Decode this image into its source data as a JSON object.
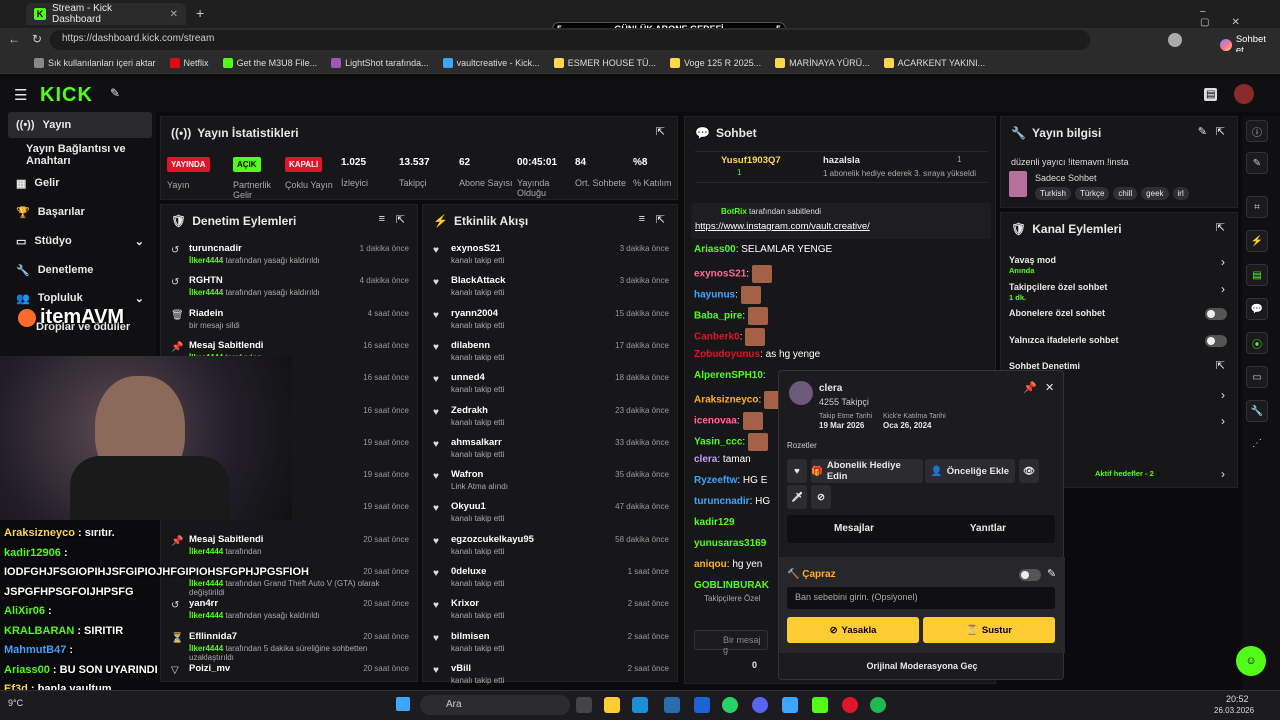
{
  "browser": {
    "tab_title": "Stream - Kick Dashboard",
    "url": "https://dashboard.kick.com/stream",
    "profile_label": "Sohbet et",
    "bookmarks": [
      "Sık kullanılanları içeri aktar",
      "Netflix",
      "Get the M3U8 File...",
      "LightShot tarafında...",
      "vaultcreative - Kick...",
      "ESMER HOUSE TÜ...",
      "Voge 125 R 2025...",
      "MARİNAYA YÜRÜ...",
      "ACARKENT YAKINI..."
    ]
  },
  "goal": {
    "left": "5",
    "label": "GÜNLÜK ABONE GEDEFİ",
    "right": "5"
  },
  "logo": "KICK",
  "sidebar": [
    "Yayın",
    "Yayın Bağlantısı ve Anahtarı",
    "Gelir",
    "Başarılar",
    "Stüdyo",
    "Denetleme",
    "Topluluk",
    "Droplar ve ödüller"
  ],
  "stats": {
    "title": "Yayın İstatistikleri",
    "items": [
      {
        "badge": "YAYINDA",
        "color": "#e0142b",
        "label": "Yayın"
      },
      {
        "badge": "AÇIK",
        "color": "#53fc18",
        "label": "Partnerlik Gelir"
      },
      {
        "badge": "KAPALI",
        "color": "#e0142b",
        "label": "Çoklu Yayın"
      },
      {
        "value": "1.025",
        "label": "İzleyici"
      },
      {
        "value": "13.537",
        "label": "Takipçi"
      },
      {
        "value": "62",
        "label": "Abone Sayısı"
      },
      {
        "value": "00:45:01",
        "label": "Yayında Olduğu"
      },
      {
        "value": "84",
        "label": "Ort. Sohbete"
      },
      {
        "value": "%8",
        "label": "% Katılım"
      }
    ]
  },
  "mod": {
    "title": "Denetim Eylemleri",
    "rows": [
      {
        "name": "turuncnadir",
        "sub": "İlker4444",
        "rest": " tarafından yasağı kaldırıldı",
        "time": "1 dakika önce",
        "icon": "↺"
      },
      {
        "name": "RGHTN",
        "sub": "İlker4444",
        "rest": " tarafından yasağı kaldırıldı",
        "time": "4 dakika önce",
        "icon": "↺"
      },
      {
        "name": "Riadein",
        "sub": "",
        "rest": "bir mesajı sildi",
        "time": "4 saat önce",
        "icon": "🗑"
      },
      {
        "name": "Mesaj Sabitlendi",
        "sub": "İlker4444",
        "rest": " tarafından",
        "time": "16 saat önce",
        "icon": "📌"
      },
      {
        "name": "",
        "sub": "",
        "rest": "ıldı",
        "time": "16 saat önce",
        "icon": ""
      },
      {
        "name": "",
        "sub": "",
        "rest": "ıldı",
        "time": "16 saat önce",
        "icon": ""
      },
      {
        "name": "",
        "sub": "",
        "rest": "ldı",
        "time": "19 saat önce",
        "icon": ""
      },
      {
        "name": "",
        "sub": "",
        "rest": "ldı",
        "time": "19 saat önce",
        "icon": ""
      },
      {
        "name": "",
        "sub": "",
        "rest": "",
        "time": "19 saat önce",
        "icon": ""
      },
      {
        "name": "Mesaj Sabitlendi",
        "sub": "İlker4444",
        "rest": " tarafından",
        "time": "20 saat önce",
        "icon": "📌"
      },
      {
        "name": "",
        "sub": "İlker4444",
        "rest": " tarafından Grand Theft Auto V (GTA) olarak değiştirildi",
        "time": "20 saat önce",
        "icon": ""
      },
      {
        "name": "yan4rr",
        "sub": "İlker4444",
        "rest": " tarafından yasağı kaldırıldı",
        "time": "20 saat önce",
        "icon": "↺"
      },
      {
        "name": "Efllinnida7",
        "sub": "İlker4444",
        "rest": " tarafından 5 dakika süreliğine sohbetten uzaklaştırıldı",
        "time": "20 saat önce",
        "icon": "⏳"
      },
      {
        "name": "Poizi_mv",
        "sub": "",
        "rest": "",
        "time": "20 saat önce",
        "icon": "▽"
      }
    ]
  },
  "activity": {
    "title": "Etkinlik Akışı",
    "rows": [
      {
        "name": "exynosS21",
        "sub": "kanalı takip etti",
        "time": "3 dakika önce"
      },
      {
        "name": "BlackAttack",
        "sub": "kanalı takip etti",
        "time": "3 dakika önce"
      },
      {
        "name": "ryann2004",
        "sub": "kanalı takip etti",
        "time": "15 dakika önce"
      },
      {
        "name": "dilabenn",
        "sub": "kanalı takip etti",
        "time": "17 dakika önce"
      },
      {
        "name": "unned4",
        "sub": "kanalı takip etti",
        "time": "18 dakika önce"
      },
      {
        "name": "Zedrakh",
        "sub": "kanalı takip etti",
        "time": "23 dakika önce"
      },
      {
        "name": "ahmsalkarr",
        "sub": "kanalı takip etti",
        "time": "33 dakika önce"
      },
      {
        "name": "Wafron",
        "sub": "Link Atma alındı",
        "time": "35 dakika önce"
      },
      {
        "name": "Okyuu1",
        "sub": "kanalı takip etti",
        "time": "47 dakika önce"
      },
      {
        "name": "egzozcukelkayu95",
        "sub": "kanalı takip etti",
        "time": "58 dakika önce"
      },
      {
        "name": "0deluxe",
        "sub": "kanalı takip etti",
        "time": "1 saat önce"
      },
      {
        "name": "Krixor",
        "sub": "kanalı takip etti",
        "time": "2 saat önce"
      },
      {
        "name": "bilmisen",
        "sub": "kanalı takip etti",
        "time": "2 saat önce"
      },
      {
        "name": "vBill",
        "sub": "kanalı takip etti",
        "time": "2 saat önce"
      }
    ]
  },
  "chat": {
    "title": "Sohbet",
    "top_user": "Yusuf1903Q7",
    "top_count": "1",
    "gifted_by": "hazalsla",
    "gift_count": "1",
    "gift_text": "1 abonelik hediye ederek 3. sıraya yükseldi",
    "pinned_by": "BotRix",
    "pinned_suffix": " tarafından sabitlendi",
    "pinned_link": "https://www.instagram.com/vault.creative/",
    "lines": [
      {
        "user": "Ariass00",
        "color": "#53fc18",
        "msg": ": SELAMLAR YENGE",
        "emote": false
      },
      {
        "user": "exynosS21",
        "color": "#ff6b9a",
        "msg": ":",
        "emote": true
      },
      {
        "user": "hayunus",
        "color": "#3ea6ff",
        "msg": ":",
        "emote": true
      },
      {
        "user": "Baba_pire",
        "color": "#53fc18",
        "msg": ":",
        "emote": true
      },
      {
        "user": "Canberk0",
        "color": "#e0142b",
        "msg": ":",
        "emote": true
      },
      {
        "user": "Zobudoyunus",
        "color": "#e0142b",
        "msg": ": as hg yenge",
        "emote": false
      },
      {
        "user": "AlperenSPH10",
        "color": "#53fc18",
        "msg": ":",
        "emote": false
      },
      {
        "user": "Araksizneyco",
        "color": "#ffb020",
        "msg": ":",
        "emote": true
      },
      {
        "user": "icenovaa",
        "color": "#ff6b9a",
        "msg": ":",
        "emote": true
      },
      {
        "user": "Yasin_ccc",
        "color": "#53fc18",
        "msg": ":",
        "emote": true
      },
      {
        "user": "clera",
        "color": "#c49bff",
        "msg": ": taman",
        "emote": false
      },
      {
        "user": "Ryzeeftw",
        "color": "#3ea6ff",
        "msg": ": HG E",
        "emote": false
      },
      {
        "user": "turuncnadir",
        "color": "#3ea6ff",
        "msg": ": HG",
        "emote": false
      },
      {
        "user": "kadir129",
        "color": "#53fc18",
        "msg": "",
        "emote": false
      },
      {
        "user": "yunusaras3169",
        "color": "#53fc18",
        "msg": "",
        "emote": false
      },
      {
        "user": "aniqou",
        "color": "#ffb020",
        "msg": ": hg yen",
        "emote": false
      },
      {
        "user": "GOBLINBURAK",
        "color": "#53fc18",
        "msg": "",
        "emote": false
      }
    ],
    "footer_label": "Takipçilere Özel",
    "input_placeholder": "Bir mesaj g",
    "count": "0"
  },
  "info": {
    "title": "Yayın bilgisi",
    "stream_title": "düzenli yayıcı !itemavm !insta",
    "category": "Sadece Sohbet",
    "tags": [
      "Turkish",
      "Türkçe",
      "chill",
      "geek",
      "irl"
    ]
  },
  "channel": {
    "title": "Kanal Eylemleri",
    "rows": [
      {
        "label": "Yavaş mod",
        "sub": "Anında",
        "ctl": "arrow"
      },
      {
        "label": "Takipçilere özel sohbet",
        "sub": "1 dk.",
        "ctl": "arrow"
      },
      {
        "label": "Abonelere özel sohbet",
        "sub": "",
        "ctl": "toggle"
      },
      {
        "label": "Yalnızca ifadelerle sohbet",
        "sub": "",
        "ctl": "toggle"
      },
      {
        "label": "Sohbet Denetimi",
        "sub": "",
        "ctl": "ext"
      },
      {
        "label": "laması",
        "sub": "",
        "ctl": "arrow"
      },
      {
        "label": "imeler",
        "sub": "",
        "ctl": "arrow"
      },
      {
        "label": "ir",
        "sub": "",
        "ctl": ""
      },
      {
        "label": "yin",
        "sub": "Aktif hedefler - 2",
        "ctl": "arrow"
      }
    ]
  },
  "popup": {
    "username": "clera",
    "followers": "4255 Takipçi",
    "follow_label": "Takip Etme Tarihi",
    "follow_date": "19 Mar 2026",
    "join_label": "Kick'e Katılma Tarihi",
    "join_date": "Oca 26, 2024",
    "badges_label": "Rozetler",
    "btn_gift": "Abonelik Hediye Edin",
    "btn_priority": "Önceliğe Ekle",
    "tab_messages": "Mesajlar",
    "tab_replies": "Yanıtlar",
    "section": "Çapraz",
    "reason_placeholder": "Ban sebebini girin. (Opsiyonel)",
    "btn_ban": "Yasakla",
    "btn_timeout": "Sustur",
    "original": "Orijinal Moderasyona Geç"
  },
  "overlay": {
    "brand": "itemAVM",
    "chat": [
      {
        "user": "Araksizneyco",
        "color": "#ffd84a",
        "msg": " : sırıtır."
      },
      {
        "user": "kadir12906",
        "color": "#53fc18",
        "msg": " :"
      },
      {
        "user": "",
        "color": "#fff",
        "msg": "IODFGHJFSGIOPIHJSFGIPIOJHFGIPIOHSFGPHJPGSFIOH"
      },
      {
        "user": "",
        "color": "#fff",
        "msg": "JSPGFHPSGFOIJHPSFG"
      },
      {
        "user": "AliXir06",
        "color": "#53fc18",
        "msg": " :"
      },
      {
        "user": "KRALBARAN",
        "color": "#53fc18",
        "msg": " : SIRITIR"
      },
      {
        "user": "MahmutB47",
        "color": "#3ea6ff",
        "msg": " :"
      },
      {
        "user": "Ariass00",
        "color": "#53fc18",
        "msg": " : BU SON UYARINDI"
      },
      {
        "user": "Ef3d",
        "color": "#ffd84a",
        "msg": " : banla vaultum"
      },
      {
        "user": "allllan7777",
        "color": "#fff",
        "msg": " : AMANİİİİN"
      }
    ]
  },
  "taskbar": {
    "search": "Ara",
    "weather": "9°C",
    "time": "20:52",
    "date": "26.03.2026"
  }
}
